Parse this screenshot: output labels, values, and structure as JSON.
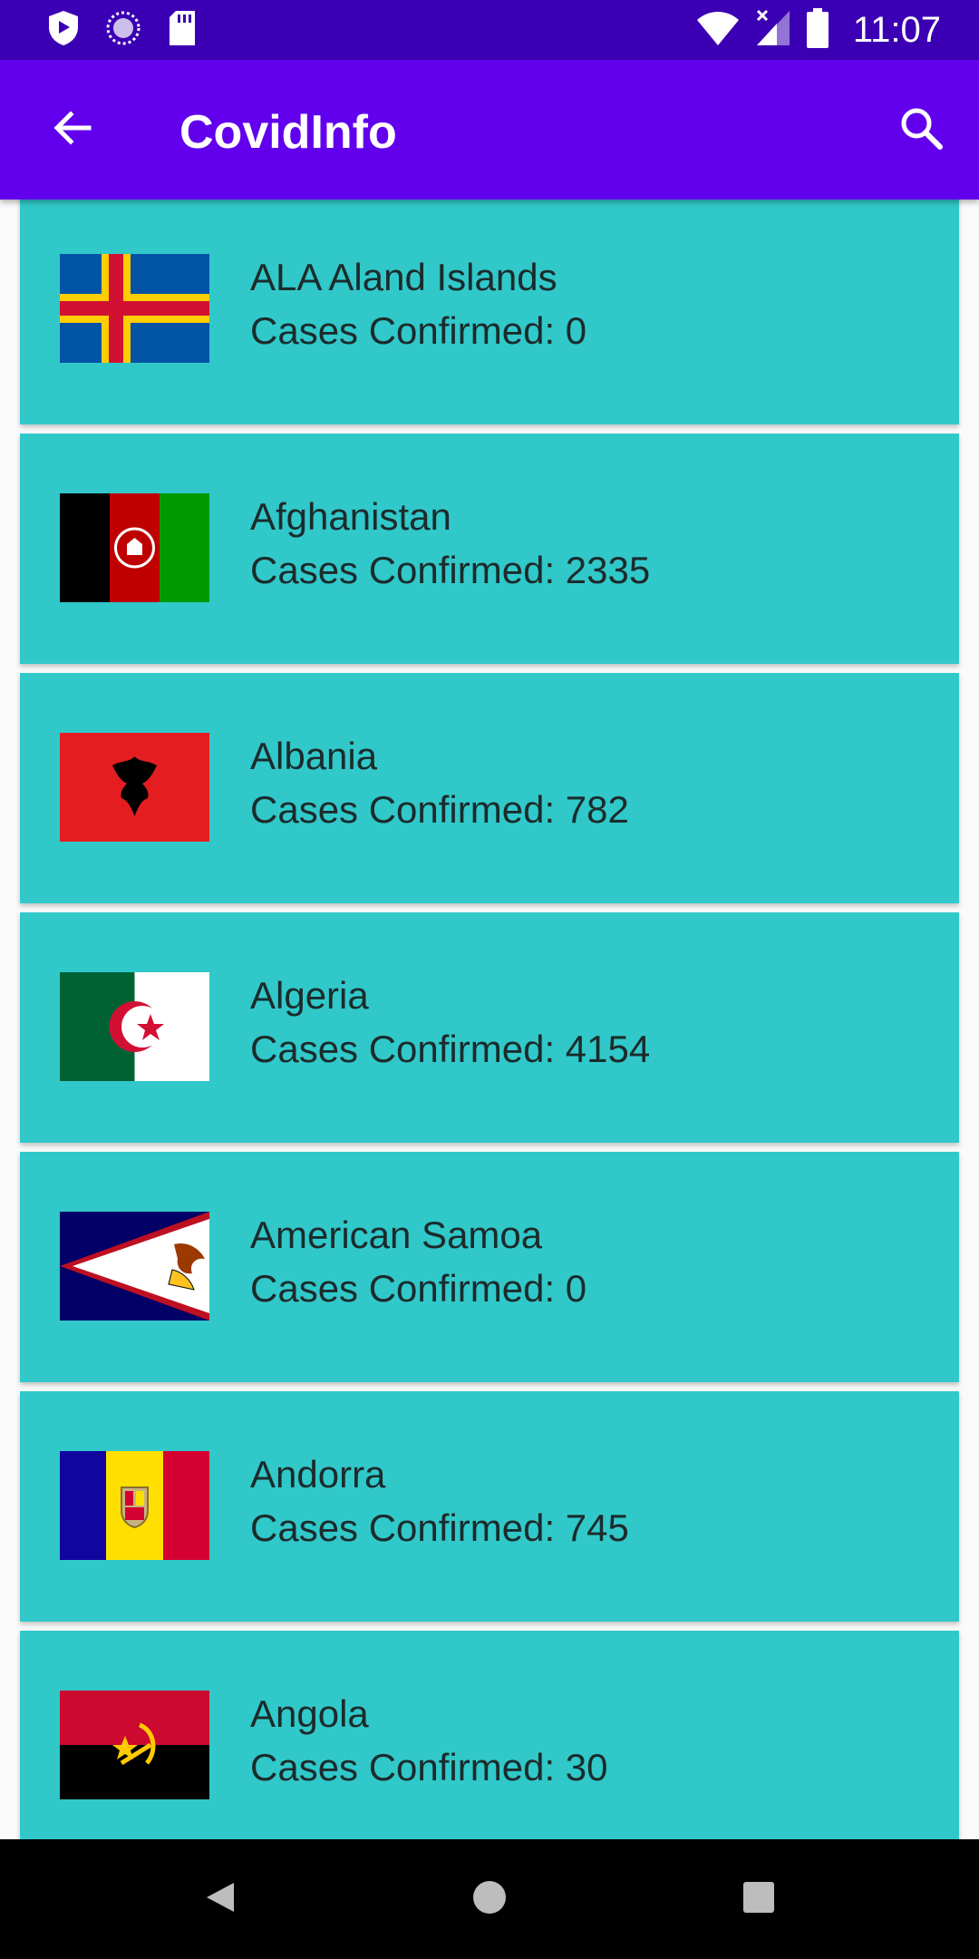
{
  "status_bar": {
    "time": "11:07",
    "icons": [
      "shield-icon",
      "sync-icon",
      "sd-card-icon",
      "wifi-icon",
      "signal-icon",
      "battery-icon"
    ]
  },
  "app_bar": {
    "title": "CovidInfo",
    "back_icon": "arrow-back-icon",
    "search_icon": "search-icon"
  },
  "countries": [
    {
      "name": "ALA Aland Islands",
      "cases": "Cases Confirmed: 0",
      "flag": "aland-islands-flag-icon"
    },
    {
      "name": "Afghanistan",
      "cases": "Cases Confirmed: 2335",
      "flag": "afghanistan-flag-icon"
    },
    {
      "name": "Albania",
      "cases": "Cases Confirmed: 782",
      "flag": "albania-flag-icon"
    },
    {
      "name": "Algeria",
      "cases": "Cases Confirmed: 4154",
      "flag": "algeria-flag-icon"
    },
    {
      "name": "American Samoa",
      "cases": "Cases Confirmed: 0",
      "flag": "american-samoa-flag-icon"
    },
    {
      "name": "Andorra",
      "cases": "Cases Confirmed: 745",
      "flag": "andorra-flag-icon"
    },
    {
      "name": "Angola",
      "cases": "Cases Confirmed: 30",
      "flag": "angola-flag-icon"
    }
  ],
  "nav_bar": {
    "icons": [
      "nav-back-icon",
      "home-icon",
      "recents-icon"
    ]
  },
  "colors": {
    "status_bar": "#3b00b3",
    "app_bar": "#6200ee",
    "card": "#31c8ca",
    "card_text": "#1c2b2b"
  }
}
